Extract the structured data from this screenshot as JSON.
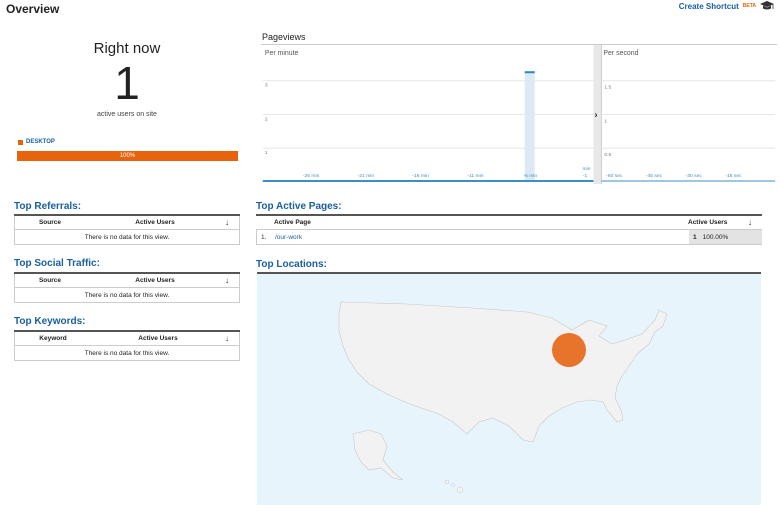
{
  "header": {
    "title": "Overview",
    "create_shortcut": "Create Shortcut",
    "beta": "BETA"
  },
  "right_now": {
    "label": "Right now",
    "count": "1",
    "sub": "active users on site",
    "device_label": "DESKTOP",
    "device_percent": "100%",
    "device_fraction": 1.0,
    "colors": {
      "accent": "#e8640c"
    }
  },
  "pageviews": {
    "title": "Pageviews",
    "per_minute": "Per minute",
    "per_second": "Per second",
    "minute_y_ticks": [
      "3",
      "2",
      "1"
    ],
    "minute_x_ticks": [
      "-26 min",
      "-21 min",
      "-16 min",
      "-11 min",
      "-6 min",
      "-1"
    ],
    "minute_unit": "min",
    "second_y_ticks": [
      "1.5",
      "1",
      "0.5"
    ],
    "second_x_ticks": [
      "-60 sec",
      "-45 sec",
      "-30 sec",
      "-15 sec"
    ]
  },
  "chart_data": [
    {
      "type": "bar",
      "title": "Per minute",
      "x": [
        -29,
        -28,
        -27,
        -26,
        -25,
        -24,
        -23,
        -22,
        -21,
        -20,
        -19,
        -18,
        -17,
        -16,
        -15,
        -14,
        -13,
        -12,
        -11,
        -10,
        -9,
        -8,
        -7,
        -6,
        -5,
        -4,
        -3,
        -2,
        -1
      ],
      "values": [
        0,
        0,
        0,
        0,
        0,
        0,
        0,
        0,
        0,
        0,
        0,
        0,
        0,
        0,
        0,
        0,
        0,
        0,
        0,
        0,
        0,
        0,
        0,
        3,
        0,
        0,
        0,
        0,
        0
      ],
      "ylim": [
        0,
        3.5
      ],
      "xlabel": "min"
    },
    {
      "type": "bar",
      "title": "Per second",
      "x": [
        -60,
        -45,
        -30,
        -15
      ],
      "values": [
        0,
        0,
        0,
        0
      ],
      "ylim": [
        0,
        1.75
      ]
    }
  ],
  "top_referrals": {
    "title": "Top Referrals:",
    "col1": "Source",
    "col2": "Active Users",
    "empty": "There is no data for this view."
  },
  "top_social": {
    "title": "Top Social Traffic:",
    "col1": "Source",
    "col2": "Active Users",
    "empty": "There is no data for this view."
  },
  "top_keywords": {
    "title": "Top Keywords:",
    "col1": "Keyword",
    "col2": "Active Users",
    "empty": "There is no data for this view."
  },
  "top_pages": {
    "title": "Top Active Pages:",
    "col1": "Active Page",
    "col2": "Active Users",
    "rows": [
      {
        "num": "1.",
        "page": "/our-work",
        "users": "1",
        "pct": "100.00%"
      }
    ]
  },
  "top_locations": {
    "title": "Top Locations:"
  },
  "icons": {
    "sort": "arrow-down-icon",
    "expand": "chevron-right-icon",
    "hat": "graduation-cap-icon"
  }
}
